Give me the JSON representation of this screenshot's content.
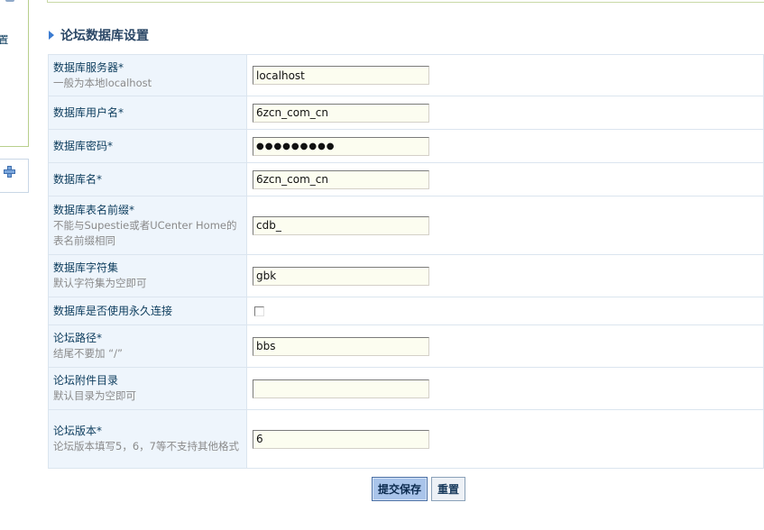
{
  "sidebar": {
    "partial_label": "置",
    "icons": [
      "plus-icon"
    ]
  },
  "section": {
    "title": "论坛数据库设置",
    "icon": "arrow-icon"
  },
  "form": {
    "rows": [
      {
        "label": "数据库服务器*",
        "hint": "一般为本地localhost",
        "type": "text",
        "value": "localhost"
      },
      {
        "label": "数据库用户名*",
        "hint": "",
        "type": "text",
        "value": "6zcn_com_cn"
      },
      {
        "label": "数据库密码*",
        "hint": "",
        "type": "password",
        "value": "●●●●●●●●●"
      },
      {
        "label": "数据库名*",
        "hint": "",
        "type": "text",
        "value": "6zcn_com_cn"
      },
      {
        "label": "数据库表名前缀*",
        "hint": "不能与Supestie或者UCenter Home的表名前缀相同",
        "type": "text",
        "value": "cdb_"
      },
      {
        "label": "数据库字符集",
        "hint": "默认字符集为空即可",
        "type": "text",
        "value": "gbk"
      },
      {
        "label": "数据库是否使用永久连接",
        "hint": "",
        "type": "checkbox",
        "value": ""
      },
      {
        "label": "论坛路径*",
        "hint": "结尾不要加 “/”",
        "type": "text",
        "value": "bbs"
      },
      {
        "label": "论坛附件目录",
        "hint": "默认目录为空即可",
        "type": "text",
        "value": ""
      },
      {
        "label": "论坛版本*",
        "hint": "论坛版本填写5，6，7等不支持其他格式",
        "type": "text",
        "value": "6"
      }
    ]
  },
  "buttons": {
    "submit_label": "提交保存",
    "reset_label": "重置"
  },
  "colors": {
    "label_bg": "#eef5fc",
    "border": "#dbe5ef",
    "input_bg": "#fcfdf0",
    "accent": "#3a7bd1",
    "submit_bg": "#a9c4ea"
  }
}
